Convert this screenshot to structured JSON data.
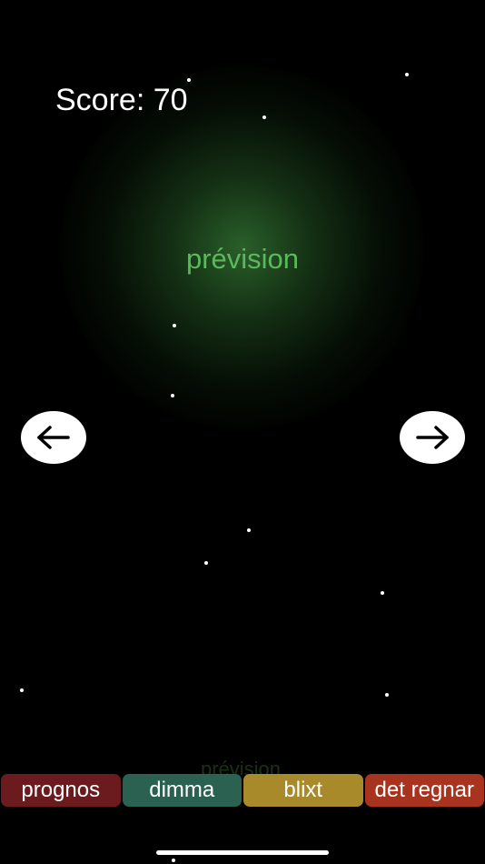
{
  "score": {
    "label": "Score: 70",
    "value": 70
  },
  "prompt_word": "prévision",
  "nav": {
    "left_icon": "arrow-left-icon",
    "right_icon": "arrow-right-icon"
  },
  "choices": [
    {
      "label": "prognos",
      "color": "#6b1a1e"
    },
    {
      "label": "dimma",
      "color": "#2a6150"
    },
    {
      "label": "blixt",
      "color": "#a88a2a"
    },
    {
      "label": "det regnar",
      "color": "#a8331f"
    }
  ],
  "faint_word": "prévision",
  "colors": {
    "background": "#000000",
    "prompt": "#5cb85c",
    "glow": "#2c642c"
  }
}
